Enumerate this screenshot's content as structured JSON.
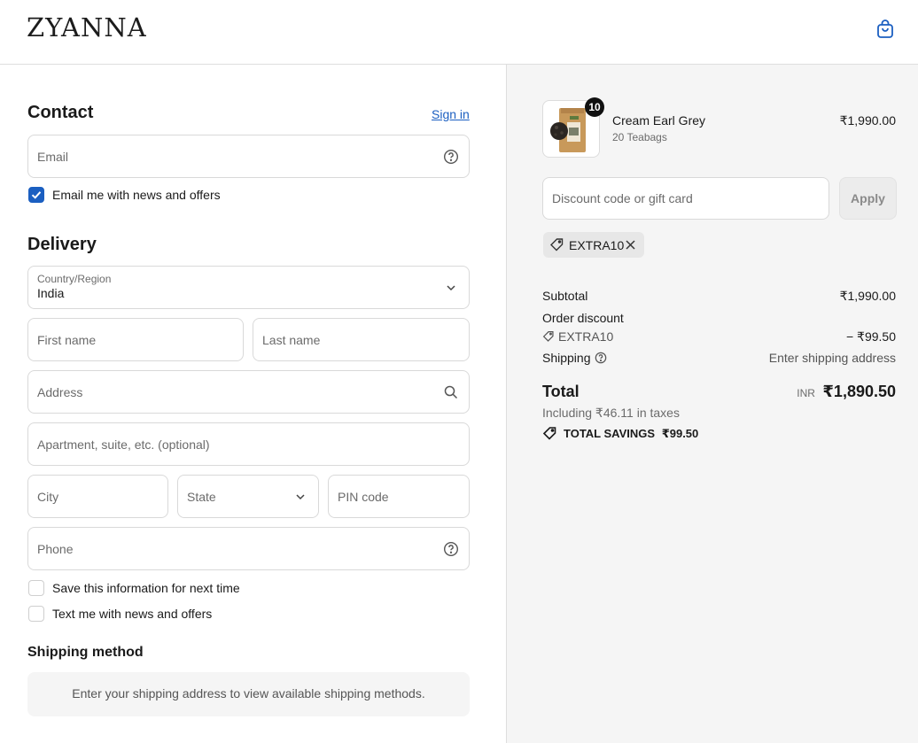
{
  "header": {
    "brand": "ZYANNA"
  },
  "contact": {
    "title": "Contact",
    "sign_in": "Sign in",
    "email_placeholder": "Email",
    "email_news_label": "Email me with news and offers"
  },
  "delivery": {
    "title": "Delivery",
    "country_label": "Country/Region",
    "country_value": "India",
    "first_name": "First name",
    "last_name": "Last name",
    "address": "Address",
    "apartment": "Apartment, suite, etc. (optional)",
    "city": "City",
    "state": "State",
    "pin": "PIN code",
    "phone": "Phone",
    "save_info_label": "Save this information for next time",
    "text_news_label": "Text me with news and offers"
  },
  "shipping_method": {
    "title": "Shipping method",
    "message": "Enter your shipping address to view available shipping methods."
  },
  "summary": {
    "product": {
      "name": "Cream Earl Grey",
      "variant": "20 Teabags",
      "price": "₹1,990.00",
      "quantity": "10"
    },
    "discount_placeholder": "Discount code or gift card",
    "apply_label": "Apply",
    "applied_code": "EXTRA10",
    "subtotal_label": "Subtotal",
    "subtotal_value": "₹1,990.00",
    "order_discount_label": "Order discount",
    "discount_code": "EXTRA10",
    "discount_value": "− ₹99.50",
    "shipping_label": "Shipping",
    "shipping_value": "Enter shipping address",
    "total_label": "Total",
    "currency": "INR",
    "total_value": "₹1,890.50",
    "taxes_note": "Including ₹46.11 in taxes",
    "total_savings_label": "TOTAL SAVINGS",
    "total_savings_value": "₹99.50"
  },
  "colors": {
    "accent": "#1b5fc1",
    "summary_bg": "#f5f5f5"
  }
}
